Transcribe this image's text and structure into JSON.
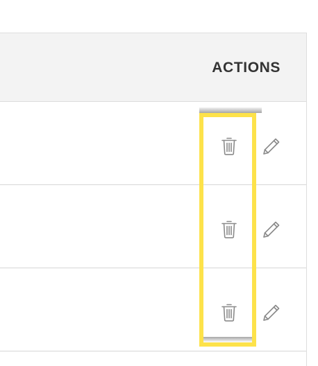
{
  "table": {
    "header": {
      "actions_label": "ACTIONS"
    },
    "rows": [
      {
        "actions": [
          "trash-icon",
          "pencil-icon"
        ]
      },
      {
        "actions": [
          "trash-icon",
          "pencil-icon"
        ]
      },
      {
        "actions": [
          "trash-icon",
          "pencil-icon"
        ]
      }
    ]
  },
  "colors": {
    "header_background": "#f3f3f3",
    "header_text": "#333333",
    "icon": "#8a8a8a",
    "row_divider": "#d6d6d6",
    "highlight": "#fde24a"
  }
}
